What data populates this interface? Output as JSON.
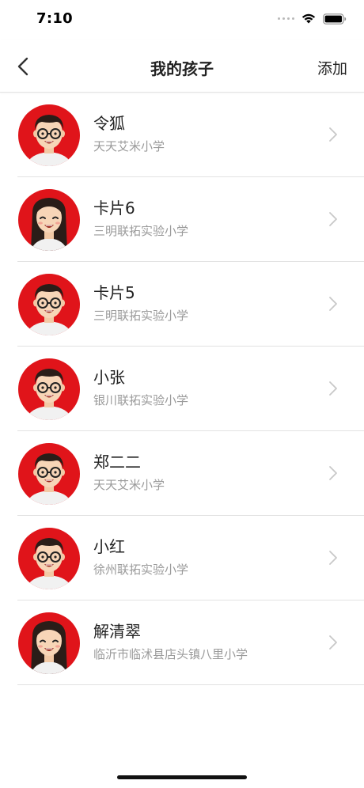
{
  "status_bar": {
    "time": "7:10"
  },
  "nav": {
    "title": "我的孩子",
    "add_label": "添加"
  },
  "children": [
    {
      "name": "令狐",
      "school": "天天艾米小学",
      "avatar": "boy-glasses-avatar"
    },
    {
      "name": "卡片6",
      "school": "三明联拓实验小学",
      "avatar": "girl-avatar"
    },
    {
      "name": "卡片5",
      "school": "三明联拓实验小学",
      "avatar": "boy-glasses-avatar"
    },
    {
      "name": "小张",
      "school": "银川联拓实验小学",
      "avatar": "boy-glasses-avatar"
    },
    {
      "name": "郑二二",
      "school": "天天艾米小学",
      "avatar": "boy-glasses-avatar"
    },
    {
      "name": "小红",
      "school": "徐州联拓实验小学",
      "avatar": "boy-glasses-avatar"
    },
    {
      "name": "解清翠",
      "school": "临沂市临沭县店头镇八里小学",
      "avatar": "girl-avatar"
    }
  ],
  "colors": {
    "avatar_bg": "#e0141a",
    "divider": "#e2e2e2",
    "secondary_text": "#9a9a9a"
  }
}
